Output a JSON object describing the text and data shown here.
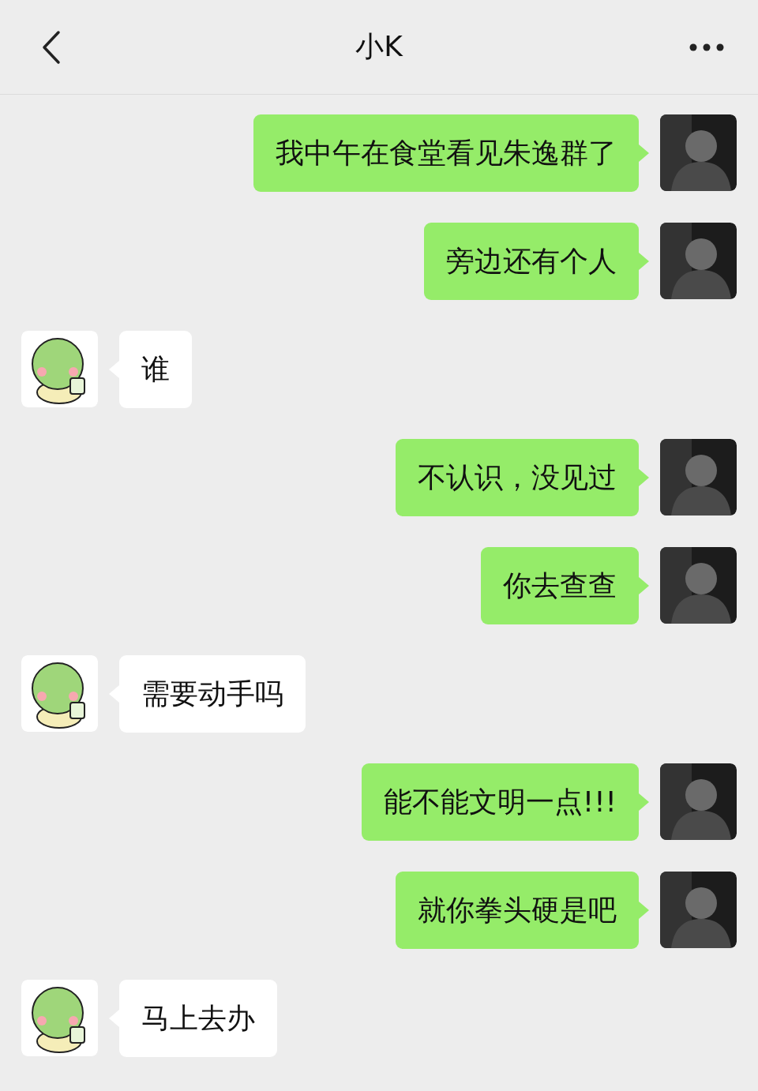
{
  "header": {
    "title": "小K"
  },
  "messages": [
    {
      "kind": "sent",
      "text": "我中午在食堂看见朱逸群了"
    },
    {
      "kind": "sent",
      "text": "旁边还有个人"
    },
    {
      "kind": "received",
      "text": "谁"
    },
    {
      "kind": "sent",
      "text": "不认识，没见过"
    },
    {
      "kind": "sent",
      "text": "你去查查"
    },
    {
      "kind": "received",
      "text": "需要动手吗"
    },
    {
      "kind": "sent",
      "text": "能不能文明一点!!!"
    },
    {
      "kind": "sent",
      "text": "就你拳头硬是吧"
    },
    {
      "kind": "received",
      "text": "马上去办"
    }
  ]
}
